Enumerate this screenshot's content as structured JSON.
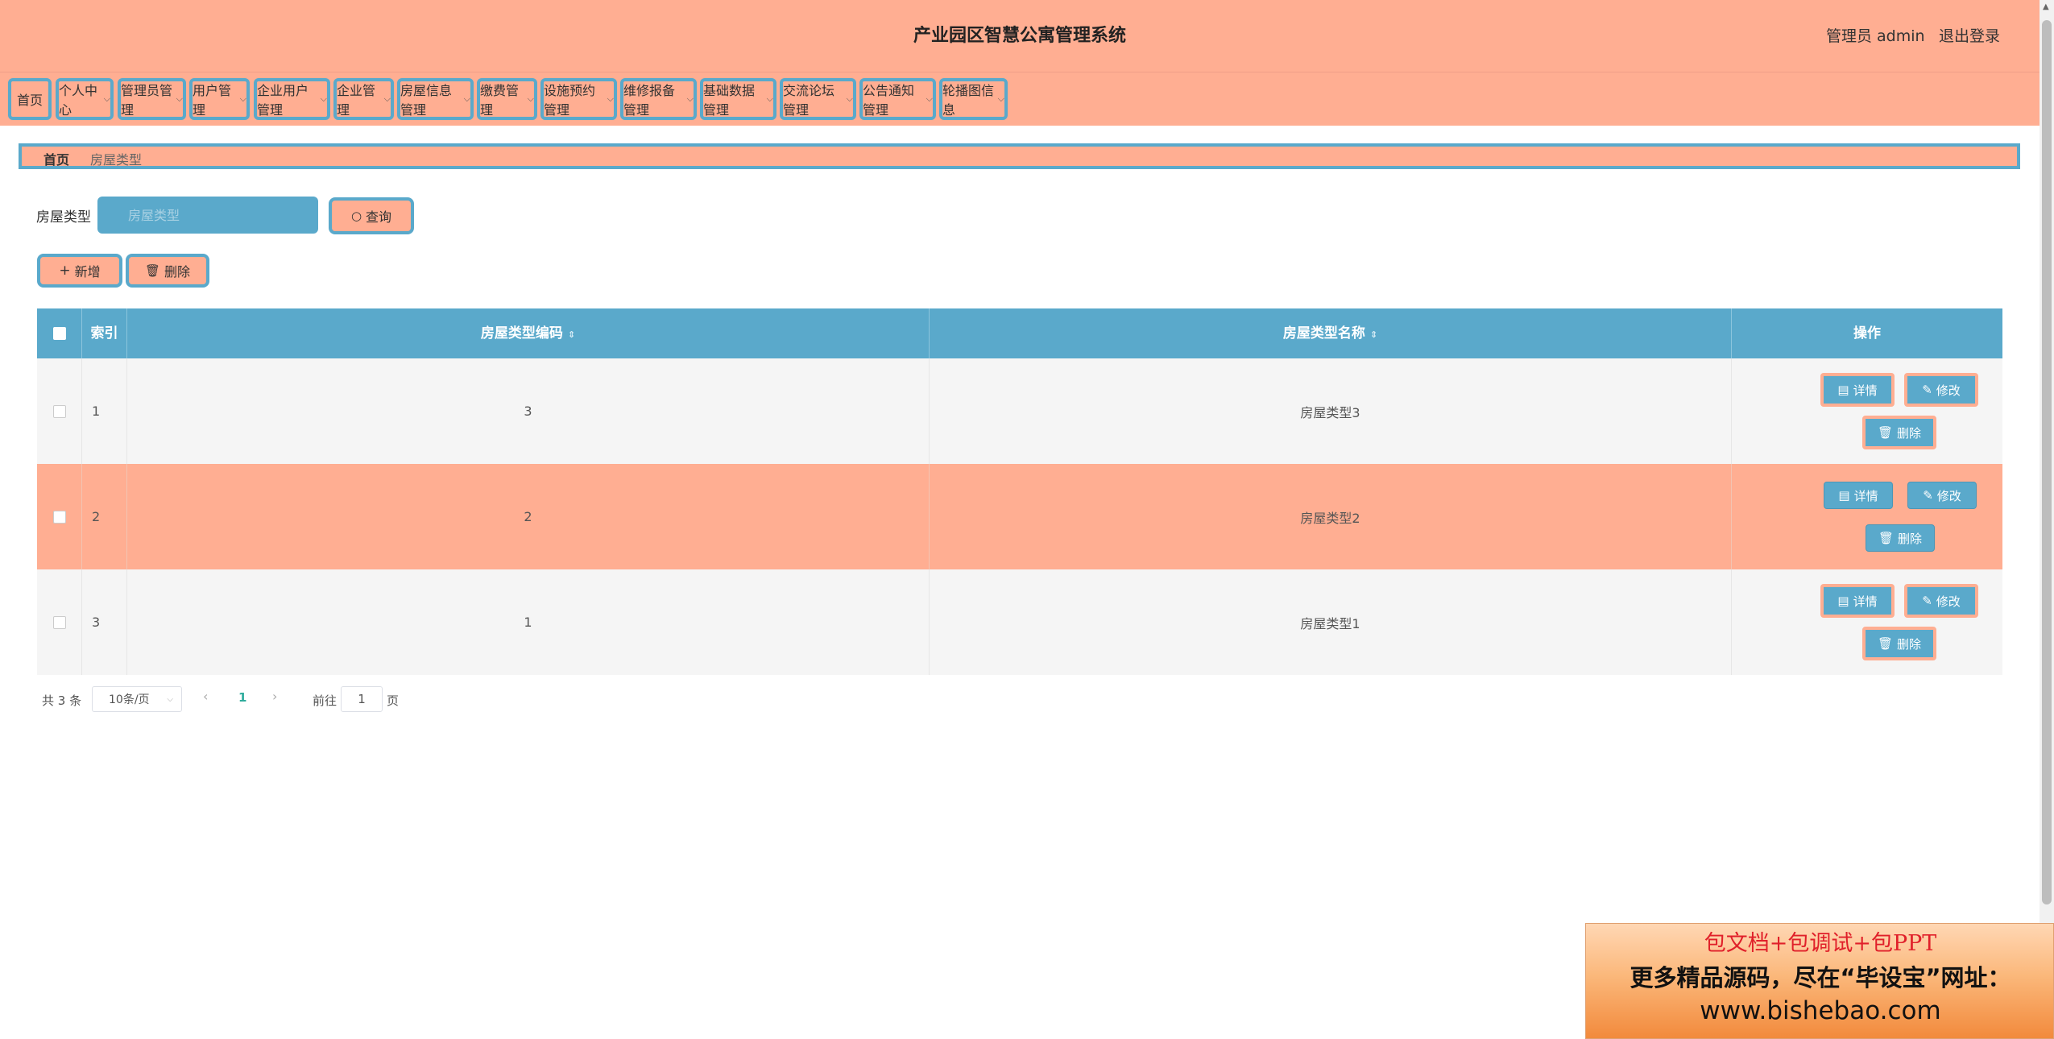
{
  "app": {
    "title": "产业园区智慧公寓管理系统",
    "user_info": "管理员 admin",
    "logout": "退出登录"
  },
  "nav": {
    "items": [
      {
        "label": "首页",
        "dropdown": false
      },
      {
        "label": "个人中心",
        "dropdown": true
      },
      {
        "label": "管理员管理",
        "dropdown": true
      },
      {
        "label": "用户管理",
        "dropdown": true
      },
      {
        "label": "企业用户管理",
        "dropdown": true
      },
      {
        "label": "企业管理",
        "dropdown": true
      },
      {
        "label": "房屋信息管理",
        "dropdown": true
      },
      {
        "label": "缴费管理",
        "dropdown": true
      },
      {
        "label": "设施预约管理",
        "dropdown": true
      },
      {
        "label": "维修报备管理",
        "dropdown": true
      },
      {
        "label": "基础数据管理",
        "dropdown": true
      },
      {
        "label": "交流论坛管理",
        "dropdown": true
      },
      {
        "label": "公告通知管理",
        "dropdown": true
      },
      {
        "label": "轮播图信息",
        "dropdown": true
      }
    ]
  },
  "breadcrumb": {
    "home": "首页",
    "current": "房屋类型"
  },
  "search": {
    "label": "房屋类型",
    "placeholder": "房屋类型",
    "value": "",
    "button": "查询"
  },
  "actions": {
    "add": "新增",
    "delete": "删除"
  },
  "table": {
    "columns": [
      "索引",
      "房屋类型编码",
      "房屋类型名称",
      "操作"
    ],
    "rows": [
      {
        "index": "1",
        "code": "3",
        "name": "房屋类型3"
      },
      {
        "index": "2",
        "code": "2",
        "name": "房屋类型2"
      },
      {
        "index": "3",
        "code": "1",
        "name": "房屋类型1"
      }
    ],
    "ops": {
      "detail": "详情",
      "edit": "修改",
      "delete": "删除"
    }
  },
  "pagination": {
    "total": "共 3 条",
    "page_size": "10条/页",
    "current_page": "1",
    "goto_label": "前往",
    "goto_value": "1",
    "goto_suffix": "页"
  },
  "ad": {
    "line1": "包文档+包调试+包PPT",
    "line2": "更多精品源码，尽在“毕设宝”网址：",
    "line3": "www.bishebao.com"
  },
  "colors": {
    "salmon": "#ffae92",
    "blue": "#5aa9cb",
    "active_page": "#2eab9c"
  }
}
